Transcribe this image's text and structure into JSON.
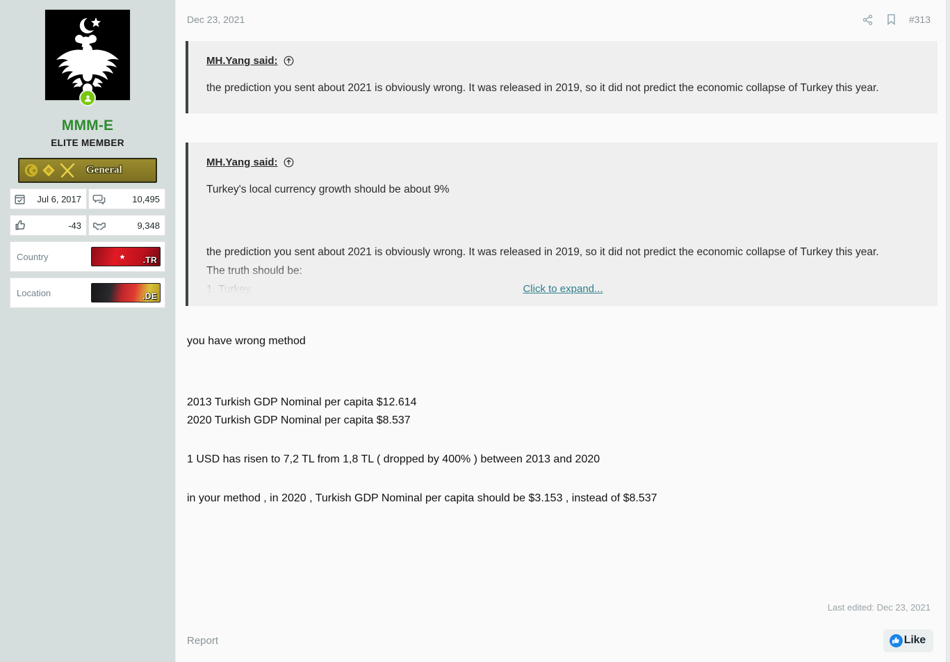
{
  "sidebar": {
    "avatar_alt": "double-headed-eagle-emblem",
    "online_status": "online",
    "username": "MMM-E",
    "user_title": "ELITE MEMBER",
    "rank": {
      "label": "General",
      "icons": [
        "crescent-star-icon",
        "diamond-icon",
        "crossed-swords-icon"
      ]
    },
    "stats": [
      {
        "icon": "calendar-icon",
        "value": "Jul 6, 2017"
      },
      {
        "icon": "messages-icon",
        "value": "10,495"
      },
      {
        "icon": "thumbs-up-icon",
        "value": "-43"
      },
      {
        "icon": "handshake-icon",
        "value": "9,348"
      }
    ],
    "info": [
      {
        "label": "Country",
        "flag_code": ".TR",
        "flag": "turkey-flag"
      },
      {
        "label": "Location",
        "flag_code": ".DE",
        "flag": "germany-flag"
      }
    ]
  },
  "post": {
    "date": "Dec 23, 2021",
    "number": "#313",
    "share_icon": "share-icon",
    "bookmark_icon": "bookmark-icon",
    "quotes": [
      {
        "author": "MH.Yang said:",
        "jump_icon": "circle-up-arrow-icon",
        "lines": [
          "the prediction you sent about 2021 is obviously wrong. It was released in 2019, so it did not predict the economic collapse of Turkey this year."
        ]
      },
      {
        "author": "MH.Yang said:",
        "jump_icon": "circle-up-arrow-icon",
        "lines": [
          "Turkey's local currency growth should be about 9%",
          "the prediction you sent about 2021 is obviously wrong. It was released in 2019, so it did not predict the economic collapse of Turkey this year."
        ],
        "truncated_lines": [
          "The truth should be:",
          "1. Turkey"
        ],
        "expand_label": "Click to expand..."
      }
    ],
    "body": {
      "line1": "you have wrong method",
      "line2": "2013 Turkish GDP Nominal per capita $12.614",
      "line3": "2020 Turkish GDP Nominal per capita $8.537",
      "line4": "1 USD has risen to 7,2 TL from 1,8 TL ( dropped by 400% ) between 2013 and 2020",
      "line5": "in your method , in 2020 , Turkish GDP Nominal per capita should be $3.153 , instead of $8.537"
    },
    "last_edited": "Last edited: Dec 23, 2021",
    "report_label": "Report",
    "like_label": "Like",
    "like_icon": "facebook-thumbs-up-icon"
  },
  "colors": {
    "sidebar_bg": "#d6dedd",
    "username": "#2e8b2e",
    "quote_bg": "#efefef",
    "quote_border": "#3d4347",
    "link": "#2f7f8f",
    "like_blue": "#1b84e7"
  }
}
